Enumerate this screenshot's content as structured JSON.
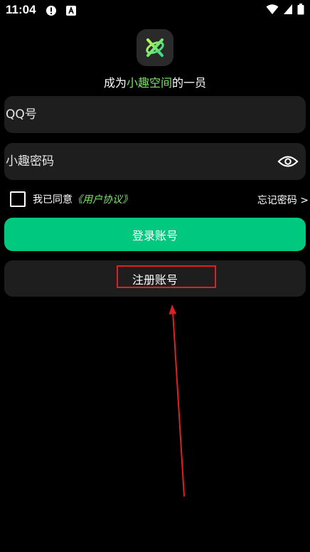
{
  "status_bar": {
    "time": "11:04",
    "left_icons": [
      "alert-icon",
      "text-a-icon"
    ],
    "right_icons": [
      "wifi-icon",
      "signal-icon",
      "battery-icon"
    ]
  },
  "app": {
    "logo": "xiaoqu-logo-icon",
    "tagline_prefix": "成为",
    "tagline_accent": "小趣空间",
    "tagline_suffix": "的一员"
  },
  "form": {
    "qq_placeholder": "QQ号",
    "qq_value": "",
    "password_placeholder": "小趣密码",
    "password_value": "",
    "show_password_icon": "eye-icon"
  },
  "agreement": {
    "checked": false,
    "text": "我已同意",
    "link": "《用户协议》",
    "forgot": "忘记密码 >"
  },
  "buttons": {
    "login": "登录账号",
    "register": "注册账号"
  },
  "colors": {
    "background": "#000000",
    "field": "#1e1e1e",
    "accent_green": "#7ee36a",
    "login_button": "#00c87f",
    "annotation": "#e02020"
  }
}
